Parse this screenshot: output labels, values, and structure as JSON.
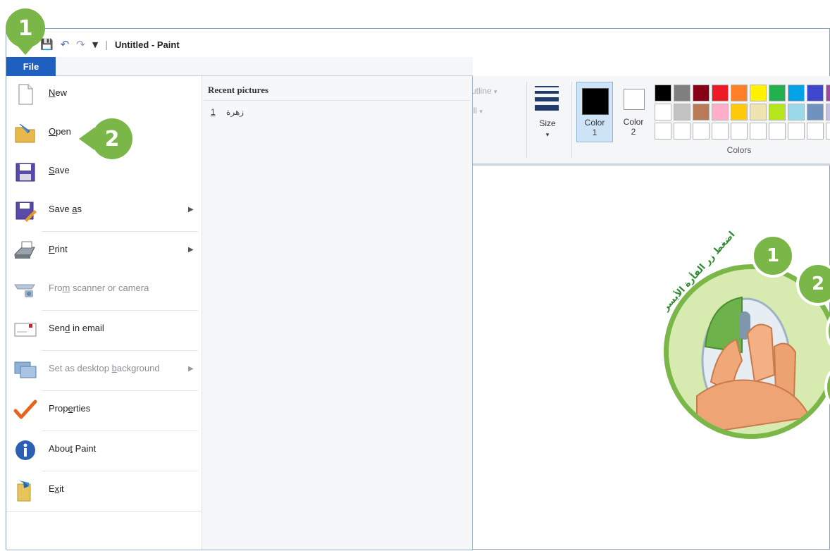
{
  "window": {
    "title": "Untitled - Paint",
    "quick_access": [
      "save-icon",
      "undo-icon",
      "redo-icon",
      "customize-icon"
    ]
  },
  "file_tab": {
    "label": "File"
  },
  "file_menu": {
    "items": [
      {
        "label": "New",
        "icon": "new-file-icon",
        "enabled": true
      },
      {
        "label": "Open",
        "icon": "open-folder-icon",
        "enabled": true
      },
      {
        "label": "Save",
        "icon": "save-icon",
        "enabled": true
      },
      {
        "label": "Save as",
        "icon": "save-as-icon",
        "enabled": true,
        "submenu": true
      },
      {
        "label": "Print",
        "icon": "printer-icon",
        "enabled": true,
        "submenu": true
      },
      {
        "label": "From scanner or camera",
        "icon": "scanner-icon",
        "enabled": false
      },
      {
        "label": "Send in email",
        "icon": "email-icon",
        "enabled": true
      },
      {
        "label": "Set as desktop background",
        "icon": "desktop-icon",
        "enabled": false,
        "submenu": true
      },
      {
        "label": "Properties",
        "icon": "checkmark-icon",
        "enabled": true
      },
      {
        "label": "About Paint",
        "icon": "info-icon",
        "enabled": true
      },
      {
        "label": "Exit",
        "icon": "exit-icon",
        "enabled": true
      }
    ],
    "recent_header": "Recent pictures",
    "recent_items": [
      {
        "num": "1",
        "name": "زهرة"
      }
    ]
  },
  "ribbon": {
    "outline_label": "utline",
    "fill_label": "ill",
    "size_label": "Size",
    "color1_label": "Color",
    "color1_num": "1",
    "color2_label": "Color",
    "color2_num": "2",
    "colors_label": "Colors",
    "palette": [
      "#000000",
      "#7f7f7f",
      "#880015",
      "#ed1c24",
      "#ff7f27",
      "#fff200",
      "#22b14c",
      "#00a2e8",
      "#3f48cc",
      "#a349a4",
      "#ffffff",
      "#c3c3c3",
      "#b97a57",
      "#ffaec9",
      "#ffc90e",
      "#efe4b0",
      "#b5e61d",
      "#99d9ea",
      "#7092be",
      "#c8bfe7",
      "#ffffff",
      "#ffffff",
      "#ffffff",
      "#ffffff",
      "#ffffff",
      "#ffffff",
      "#ffffff",
      "#ffffff",
      "#ffffff",
      "#ffffff"
    ]
  },
  "callouts": {
    "step1": "1",
    "step2": "2",
    "mouse_step1": "1",
    "mouse_step2": "2",
    "mouse_caption": "اضغط زر الفأرة الأيسر",
    "accent_color": "#7ab648"
  }
}
